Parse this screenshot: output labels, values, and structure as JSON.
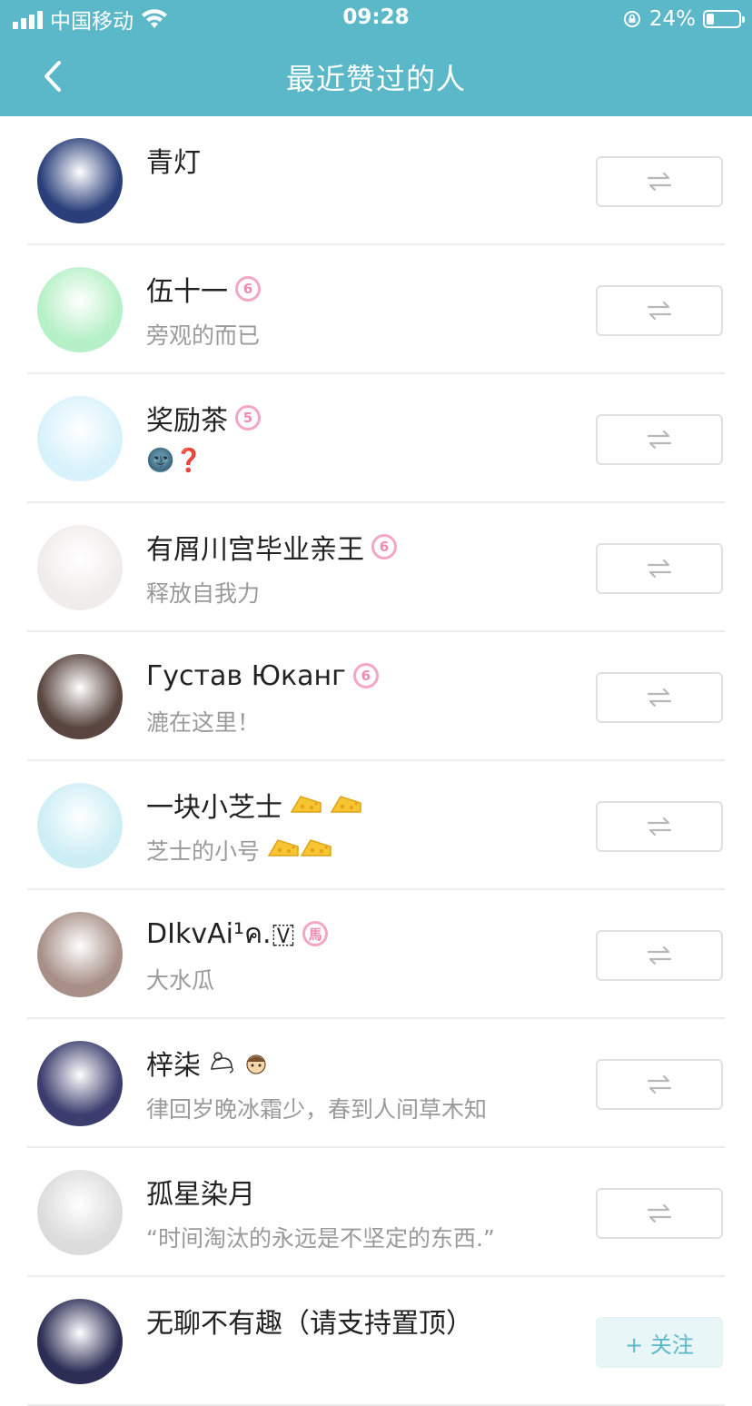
{
  "status_bar": {
    "carrier": "中国移动",
    "time": "09:28",
    "battery_pct": "24%",
    "battery_level": 0.24
  },
  "nav": {
    "title": "最近赞过的人"
  },
  "users": [
    {
      "name": "青灯",
      "subtitle": "",
      "badge": "",
      "avatar_color": "#2a3f7a",
      "button": "mutual-follow"
    },
    {
      "name": "伍十一",
      "subtitle": "旁观的而已",
      "badge": "6",
      "avatar_color": "#b6f0c6",
      "button": "mutual-follow"
    },
    {
      "name": "奖励茶",
      "subtitle": "🌚❓",
      "badge": "5",
      "avatar_color": "#d8f2fb",
      "button": "mutual-follow"
    },
    {
      "name": "有屑川宫毕业亲王",
      "subtitle": "释放自我力",
      "badge": "6",
      "avatar_color": "#f1ecec",
      "button": "mutual-follow"
    },
    {
      "name": "Густав  Юканг",
      "subtitle": "漉在这里！",
      "badge": "6",
      "avatar_color": "#5a4640",
      "button": "mutual-follow"
    },
    {
      "name": "一块小芝士",
      "subtitle": "芝士的小号",
      "badge": "",
      "avatar_color": "#cdeef5",
      "button": "mutual-follow"
    },
    {
      "name": "DIkvAi¹ค.🇻",
      "subtitle": "大水瓜",
      "badge": "馬",
      "avatar_color": "#a89088",
      "button": "mutual-follow"
    },
    {
      "name": "梓柒",
      "subtitle": "律回岁晚冰霜少，春到人间草木知",
      "badge": "",
      "avatar_color": "#3b3d6e",
      "button": "mutual-follow"
    },
    {
      "name": "孤星染月",
      "subtitle": "“时间淘汰的永远是不坚定的东西.”",
      "badge": "",
      "avatar_color": "#dcdcdc",
      "button": "mutual-follow"
    },
    {
      "name": "无聊不有趣（请支持置顶）",
      "subtitle": "",
      "badge": "",
      "avatar_color": "#2b2d55",
      "button": "follow"
    }
  ],
  "follow_label": "+ 关注",
  "colors": {
    "header": "#5ab8c9",
    "badge_pink": "#f08ab0",
    "divider": "#ececec"
  }
}
